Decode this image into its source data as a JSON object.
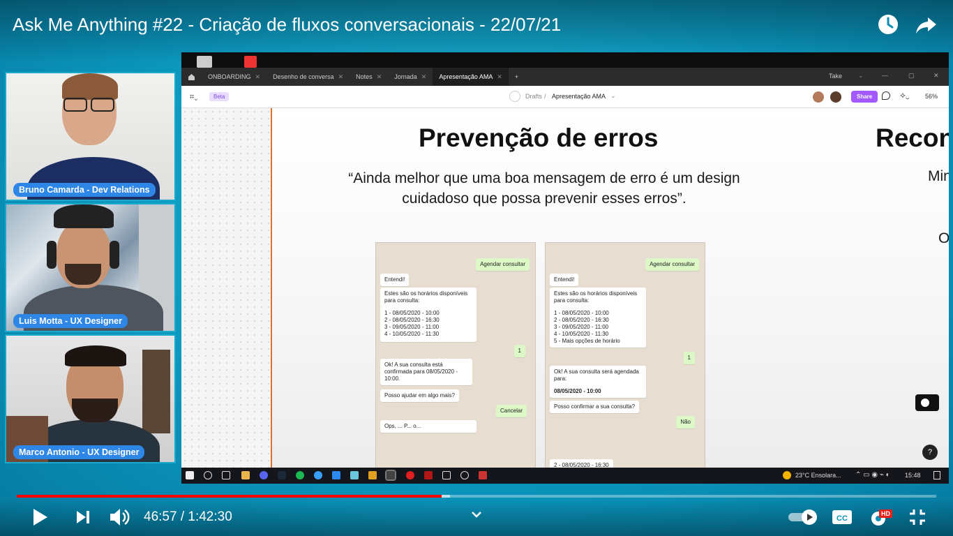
{
  "video": {
    "title": "Ask Me Anything #22 - Criação de fluxos conversacionais - 22/07/21",
    "current_time": "46:57 / 1:42:30",
    "progress_fraction": 0.462,
    "buffered_fraction": 0.471,
    "progress_color": "#ff0000",
    "top_icons": [
      "watch-later-icon",
      "share-icon"
    ],
    "control_icons": [
      "play-icon",
      "next-icon",
      "volume-icon",
      "chevron-down-icon",
      "autoplay-toggle",
      "cc-icon",
      "settings-icon",
      "exit-fullscreen-icon"
    ],
    "hd_badge": "HD"
  },
  "participants": [
    {
      "name": "Bruno Camarda - Dev Relations"
    },
    {
      "name": "Luis Motta - UX Designer"
    },
    {
      "name": "Marco Antonio - UX Designer"
    }
  ],
  "screen": {
    "tabs": [
      "ONBOARDING",
      "Desenho de conversa",
      "Notes",
      "Jornada",
      "Apresentação AMA"
    ],
    "window_user": "Take",
    "beta_badge": "Beta",
    "breadcrumb_root": "Drafts",
    "breadcrumb_sep": "/",
    "breadcrumb_file": "Apresentação AMA",
    "share_label": "Share",
    "zoom": "56%",
    "slide": {
      "title": "Prevenção de erros",
      "title_next": "Recon",
      "quote": "“Ainda melhor que uma boa mensagem de erro é um design cuidadoso que possa prevenir esses erros”.",
      "quote_next": "Min",
      "side_letter": "O"
    },
    "chat_left": {
      "agendar": "Agendar consultar",
      "entendi": "Entendi!",
      "horarios_title": "Estes são os horários disponíveis para consulta:",
      "options": [
        "1 - 08/05/2020 - 10:00",
        "2 - 08/05/2020 - 16:30",
        "3 - 09/05/2020 - 11:00",
        "4 - 10/05/2020 - 11:30"
      ],
      "reply_one": "1",
      "confirm": "Ok! A sua consulta está confirmada para 08/05/2020 - 10:00.",
      "ajudar": "Posso ajudar em algo mais?",
      "cancelar": "Cancelar",
      "partial": "Ops, ... P... o..."
    },
    "chat_right": {
      "agendar": "Agendar consultar",
      "entendi": "Entendi!",
      "horarios_title": "Estes são os horários disponíveis para consulta:",
      "options": [
        "1 - 08/05/2020 - 10:00",
        "2 - 08/05/2020 - 16:30",
        "3 - 09/05/2020 - 11:00",
        "4 - 10/05/2020 - 11:30",
        "5 - Mais opções de horário"
      ],
      "reply_one": "1",
      "sera": "Ok! A sua consulta será agendada para:",
      "date": "08/05/2020 - 10:00",
      "confirmar": "Posso confirmar a sua consulta?",
      "nao": "Não",
      "bottom": "2 - 08/05/2020 - 16:30"
    },
    "taskbar": {
      "weather": "23°C Ensolara...",
      "clock": "15:48"
    },
    "help": "?"
  }
}
